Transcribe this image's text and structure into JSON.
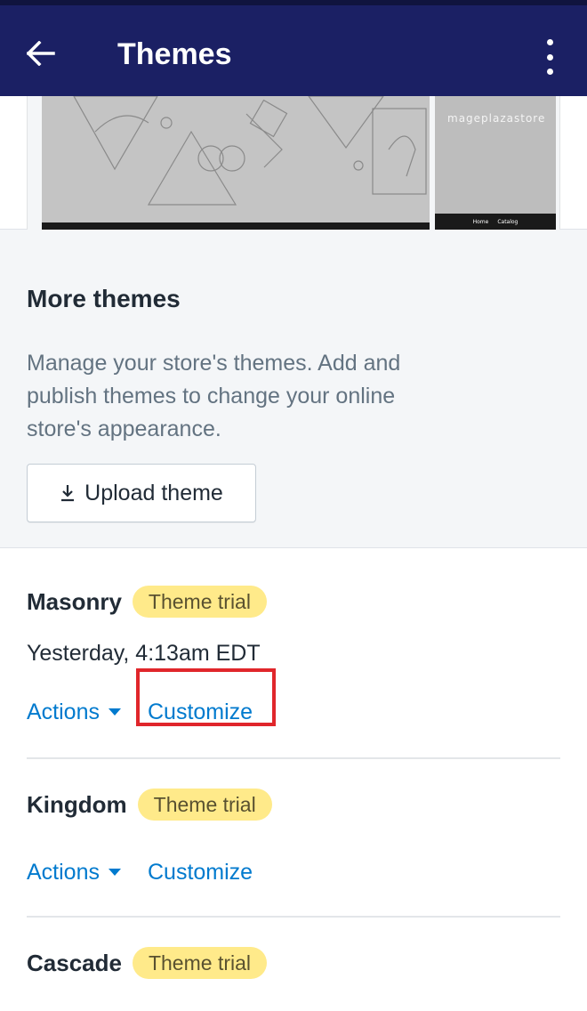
{
  "header": {
    "title": "Themes",
    "back_icon": "arrow-left-icon",
    "menu_icon": "vertical-ellipsis-icon",
    "background": "#1b2064"
  },
  "preview": {
    "store_name": "mageplazastore",
    "mobile_nav": [
      "Home",
      "Catalog"
    ]
  },
  "more_themes": {
    "title": "More themes",
    "description": "Manage your store's themes. Add and publish themes to change your online store's appearance.",
    "upload_label": "Upload theme",
    "upload_icon": "download-icon"
  },
  "themes": [
    {
      "name": "Masonry",
      "badge": "Theme trial",
      "date": "Yesterday, 4:13am EDT",
      "actions_label": "Actions",
      "customize_label": "Customize"
    },
    {
      "name": "Kingdom",
      "badge": "Theme trial",
      "actions_label": "Actions",
      "customize_label": "Customize"
    },
    {
      "name": "Cascade",
      "badge": "Theme trial"
    }
  ],
  "colors": {
    "link": "#007ace",
    "badge_bg": "#ffea8a",
    "highlight": "#e0262b"
  }
}
